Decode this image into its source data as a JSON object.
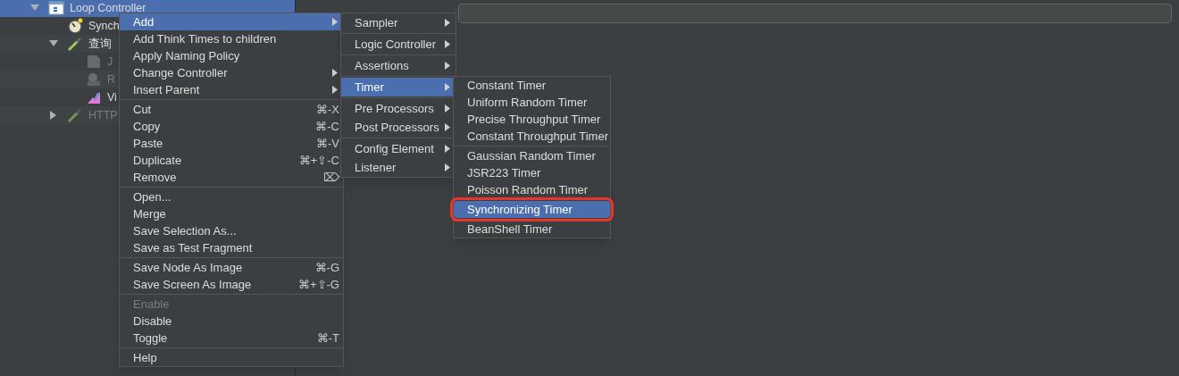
{
  "tree": [
    {
      "label": "Loop Controller",
      "kind": "loop",
      "expanded": true,
      "selected": true,
      "disabled": false,
      "children": [
        {
          "label": "Synch",
          "kind": "timer",
          "selected": false,
          "disabled": false
        },
        {
          "label": "查询",
          "kind": "sampler",
          "expanded": true,
          "selected": false,
          "disabled": false,
          "children": [
            {
              "label": "J",
              "kind": "extractor",
              "selected": false,
              "disabled": true
            },
            {
              "label": "R",
              "kind": "assertion",
              "selected": false,
              "disabled": true
            },
            {
              "label": "Vi",
              "kind": "listener",
              "selected": false,
              "disabled": false
            }
          ]
        },
        {
          "label": "HTTP",
          "kind": "sampler",
          "expanded": false,
          "selected": false,
          "disabled": true
        }
      ]
    }
  ],
  "context_menu": {
    "sections": [
      [
        {
          "label": "Add",
          "submenu": true,
          "selected": true,
          "disabled": false
        },
        {
          "label": "Add Think Times to children",
          "submenu": false,
          "selected": false,
          "disabled": false
        },
        {
          "label": "Apply Naming Policy",
          "submenu": false,
          "selected": false,
          "disabled": false
        },
        {
          "label": "Change Controller",
          "submenu": true,
          "selected": false,
          "disabled": false
        },
        {
          "label": "Insert Parent",
          "submenu": true,
          "selected": false,
          "disabled": false
        }
      ],
      [
        {
          "label": "Cut",
          "shortcut": "⌘-X",
          "submenu": false,
          "selected": false,
          "disabled": false
        },
        {
          "label": "Copy",
          "shortcut": "⌘-C",
          "submenu": false,
          "selected": false,
          "disabled": false
        },
        {
          "label": "Paste",
          "shortcut": "⌘-V",
          "submenu": false,
          "selected": false,
          "disabled": false
        },
        {
          "label": "Duplicate",
          "shortcut": "⌘+⇧-C",
          "submenu": false,
          "selected": false,
          "disabled": false
        },
        {
          "label": "Remove",
          "shortcut": "⌦",
          "submenu": false,
          "selected": false,
          "disabled": false
        }
      ],
      [
        {
          "label": "Open...",
          "submenu": false,
          "selected": false,
          "disabled": false
        },
        {
          "label": "Merge",
          "submenu": false,
          "selected": false,
          "disabled": false
        },
        {
          "label": "Save Selection As...",
          "submenu": false,
          "selected": false,
          "disabled": false
        },
        {
          "label": "Save as Test Fragment",
          "submenu": false,
          "selected": false,
          "disabled": false
        }
      ],
      [
        {
          "label": "Save Node As Image",
          "shortcut": "⌘-G",
          "submenu": false,
          "selected": false,
          "disabled": false
        },
        {
          "label": "Save Screen As Image",
          "shortcut": "⌘+⇧-G",
          "submenu": false,
          "selected": false,
          "disabled": false
        }
      ],
      [
        {
          "label": "Enable",
          "submenu": false,
          "selected": false,
          "disabled": true
        },
        {
          "label": "Disable",
          "submenu": false,
          "selected": false,
          "disabled": false
        },
        {
          "label": "Toggle",
          "shortcut": "⌘-T",
          "submenu": false,
          "selected": false,
          "disabled": false
        }
      ],
      [
        {
          "label": "Help",
          "submenu": false,
          "selected": false,
          "disabled": false
        }
      ]
    ]
  },
  "add_submenu": {
    "sections": [
      [
        {
          "label": "Sampler",
          "submenu": true,
          "selected": false,
          "disabled": false
        }
      ],
      [
        {
          "label": "Logic Controller",
          "submenu": true,
          "selected": false,
          "disabled": false
        }
      ],
      [
        {
          "label": "Assertions",
          "submenu": true,
          "selected": false,
          "disabled": false
        }
      ],
      [
        {
          "label": "Timer",
          "submenu": true,
          "selected": true,
          "disabled": false
        }
      ],
      [
        {
          "label": "Pre Processors",
          "submenu": true,
          "selected": false,
          "disabled": false
        },
        {
          "label": "Post Processors",
          "submenu": true,
          "selected": false,
          "disabled": false
        }
      ],
      [
        {
          "label": "Config Element",
          "submenu": true,
          "selected": false,
          "disabled": false
        },
        {
          "label": "Listener",
          "submenu": true,
          "selected": false,
          "disabled": false
        }
      ]
    ]
  },
  "timer_submenu": {
    "sections": [
      [
        {
          "label": "Constant Timer",
          "submenu": false,
          "selected": false,
          "disabled": false,
          "highlighted": false
        },
        {
          "label": "Uniform Random Timer",
          "submenu": false,
          "selected": false,
          "disabled": false,
          "highlighted": false
        },
        {
          "label": "Precise Throughput Timer",
          "submenu": false,
          "selected": false,
          "disabled": false,
          "highlighted": false
        },
        {
          "label": "Constant Throughput Timer",
          "submenu": false,
          "selected": false,
          "disabled": false,
          "highlighted": false
        }
      ],
      [
        {
          "label": "Gaussian Random Timer",
          "submenu": false,
          "selected": false,
          "disabled": false,
          "highlighted": false
        },
        {
          "label": "JSR223 Timer",
          "submenu": false,
          "selected": false,
          "disabled": false,
          "highlighted": false
        },
        {
          "label": "Poisson Random Timer",
          "submenu": false,
          "selected": false,
          "disabled": false,
          "highlighted": false
        },
        {
          "label": "Synchronizing Timer",
          "submenu": false,
          "selected": true,
          "disabled": false,
          "highlighted": true
        },
        {
          "label": "BeanShell Timer",
          "submenu": false,
          "selected": false,
          "disabled": false,
          "highlighted": false
        }
      ]
    ]
  }
}
